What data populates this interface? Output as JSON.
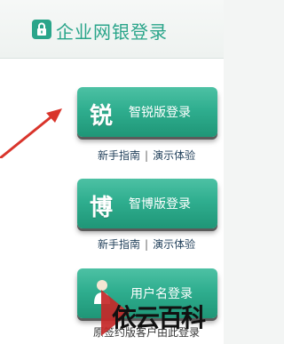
{
  "header": {
    "title": "企业网银登录",
    "icon": "lock-icon",
    "accent_color": "#2aa58a"
  },
  "buttons": [
    {
      "glyph": "锐",
      "label": "智锐版登录"
    },
    {
      "glyph": "博",
      "label": "智博版登录"
    },
    {
      "glyph": "",
      "label": "用户名登录"
    }
  ],
  "links_lite": {
    "guide": "新手指南",
    "sep": "|",
    "demo": "演示体验"
  },
  "links_bo": {
    "guide": "新手指南",
    "sep": "|",
    "demo": "演示体验"
  },
  "bottom_text": "原签约版客户由此登录",
  "watermark": {
    "text": "依云百科"
  }
}
